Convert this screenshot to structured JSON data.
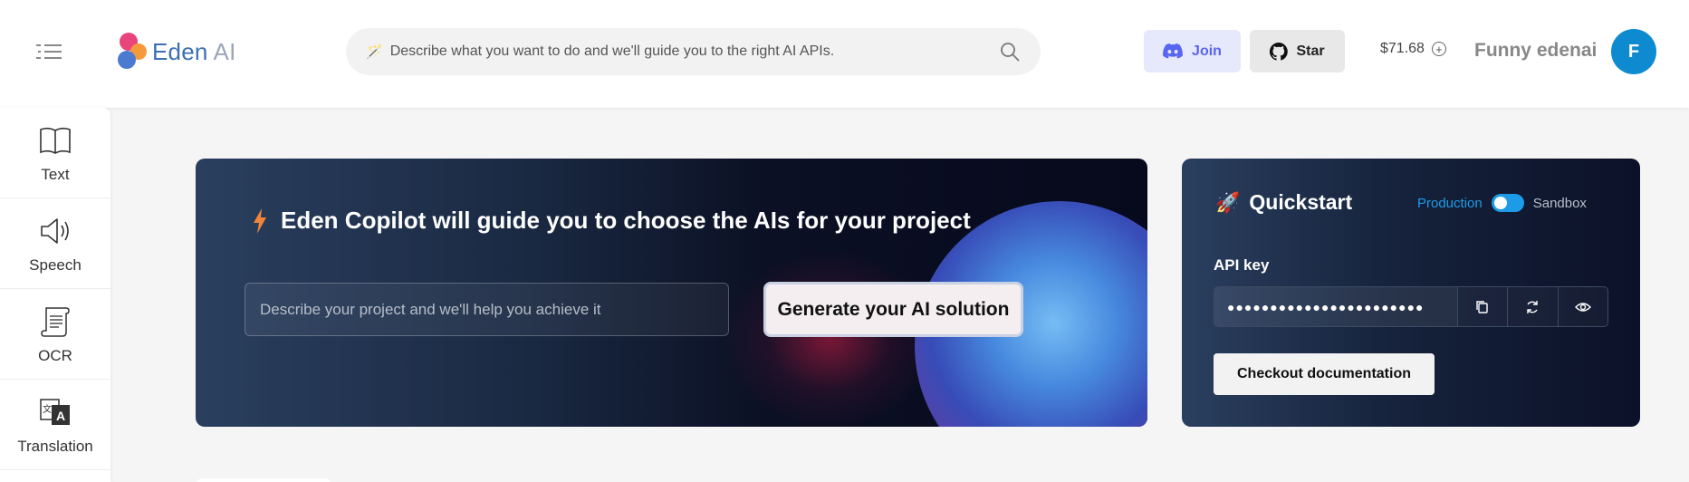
{
  "header": {
    "logo": {
      "brand": "Eden",
      "suffix": "AI"
    },
    "search": {
      "placeholder": "Describe what you want to do and we'll guide you to the right AI APIs."
    },
    "join_label": "Join",
    "star_label": "Star",
    "credits": "$71.68",
    "username": "Funny edenai",
    "avatar_initial": "F"
  },
  "sidebar": {
    "items": [
      {
        "label": "Text",
        "icon": "book-icon"
      },
      {
        "label": "Speech",
        "icon": "speaker-icon"
      },
      {
        "label": "OCR",
        "icon": "scroll-icon"
      },
      {
        "label": "Translation",
        "icon": "translate-icon"
      }
    ]
  },
  "copilot": {
    "title": "Eden Copilot will guide you to choose the AIs for your project",
    "input_placeholder": "Describe your project and we'll help you achieve it",
    "generate_label": "Generate your AI solution"
  },
  "quickstart": {
    "title": "Quickstart",
    "env_production": "Production",
    "env_sandbox": "Sandbox",
    "api_key_label": "API key",
    "api_key_value": "●●●●●●●●●●●●●●●●●●●●●●●",
    "docs_label": "Checkout documentation"
  },
  "colors": {
    "accent": "#1e9be8",
    "brand_blue": "#3b6fb4",
    "discord": "#5865f2",
    "avatar": "#0e8bd0"
  }
}
